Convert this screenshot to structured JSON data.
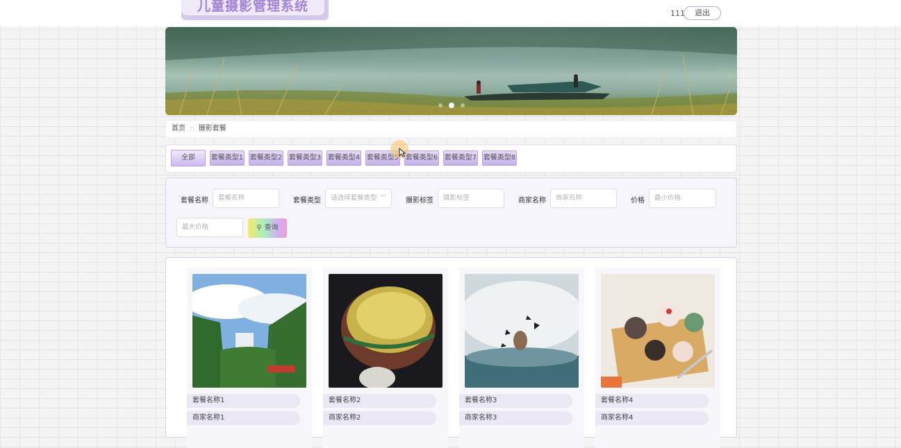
{
  "header": {
    "title": "儿童摄影管理系统",
    "username": "111",
    "logout_label": "退出"
  },
  "banner": {
    "slide_count": 3,
    "active_index": 1
  },
  "breadcrumb": {
    "home": "首页",
    "separator": "::",
    "current": "摄影套餐"
  },
  "type_tabs": [
    "全部",
    "套餐类型1",
    "套餐类型2",
    "套餐类型3",
    "套餐类型4",
    "套餐类型5",
    "套餐类型6",
    "套餐类型7",
    "套餐类型8"
  ],
  "search": {
    "name_label": "套餐名称",
    "name_placeholder": "套餐名称",
    "type_label": "套餐类型",
    "type_placeholder": "请选择套餐类型",
    "tag_label": "摄影标签",
    "tag_placeholder": "摄影标签",
    "merchant_label": "商家名称",
    "merchant_placeholder": "商家名称",
    "price_label": "价格",
    "min_placeholder": "最小价格",
    "max_placeholder": "最大价格",
    "query_label": "查询"
  },
  "products": [
    {
      "name": "套餐名称1",
      "merchant": "商家名称1",
      "image": "waterfall"
    },
    {
      "name": "套餐名称2",
      "merchant": "商家名称2",
      "image": "insect-eye"
    },
    {
      "name": "套餐名称3",
      "merchant": "商家名称3",
      "image": "mist-butterflies"
    },
    {
      "name": "套餐名称4",
      "merchant": "商家名称4",
      "image": "cupcakes"
    }
  ],
  "colors": {
    "accent": "#a482d8",
    "tab_fill": "#c5b0ea",
    "pill": "#ebe7f5"
  }
}
